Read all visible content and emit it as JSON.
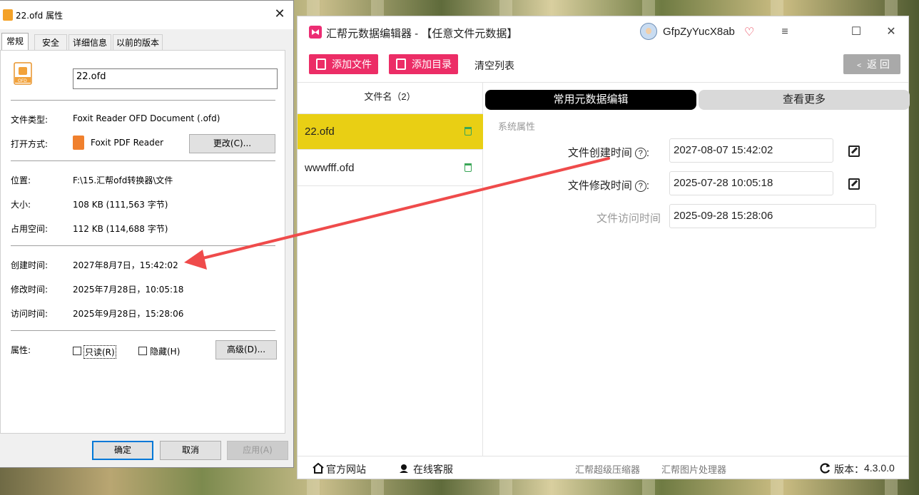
{
  "dialog": {
    "title": "22.ofd 属性",
    "close_glyph": "✕",
    "tabs": [
      "常规",
      "安全",
      "详细信息",
      "以前的版本"
    ],
    "filename": "22.ofd",
    "file_type_label": "文件类型:",
    "file_type_value": "Foxit Reader OFD Document (.ofd)",
    "open_with_label": "打开方式:",
    "open_with_value": "Foxit PDF Reader",
    "change_button": "更改(C)...",
    "location_label": "位置:",
    "location_value": "F:\\15.汇帮ofd转换器\\文件",
    "size_label": "大小:",
    "size_value": "108 KB (111,563 字节)",
    "disk_size_label": "占用空间:",
    "disk_size_value": "112 KB (114,688 字节)",
    "created_label": "创建时间:",
    "created_value": "2027年8月7日，15:42:02",
    "modified_label": "修改时间:",
    "modified_value": "2025年7月28日，10:05:18",
    "accessed_label": "访问时间:",
    "accessed_value": "2025年9月28日，15:28:06",
    "attributes_label": "属性:",
    "readonly_label": "只读(R)",
    "hidden_label": "隐藏(H)",
    "advanced_button": "高级(D)...",
    "ok_button": "确定",
    "cancel_button": "取消",
    "apply_button": "应用(A)"
  },
  "app": {
    "title": "汇帮元数据编辑器 - 【任意文件元数据】",
    "username": "GfpZyYucX8ab",
    "vip_glyph": "♡",
    "window_controls": [
      "≡",
      "☐",
      "✕"
    ],
    "toolbar": {
      "add_file": "添加文件",
      "add_folder": "添加目录",
      "clear_list": "清空列表",
      "back": "﹤ 返 回"
    },
    "file_list": {
      "header": "文件名（2）",
      "files": [
        "22.ofd",
        "wwwfff.ofd"
      ]
    },
    "tabs": {
      "common": "常用元数据编辑",
      "more": "查看更多"
    },
    "section_title": "系统属性",
    "fields": [
      {
        "label": "文件创建时间",
        "help": "?",
        "value": "2027-08-07 15:42:02"
      },
      {
        "label": "文件修改时间",
        "help": "?",
        "value": "2025-07-28 10:05:18"
      },
      {
        "label": "文件访问时间",
        "value": "2025-09-28 15:28:06"
      }
    ],
    "footer": {
      "website": "官方网站",
      "support": "在线客服",
      "compressor": "汇帮超级压缩器",
      "image_tool": "汇帮图片处理器",
      "version_label": "版本：",
      "version": "4.3.0.0"
    },
    "colors": {
      "accent": "#ec2d66",
      "selected_row": "#e9cf14",
      "annotation_arrow": "#ef4b4b"
    }
  }
}
